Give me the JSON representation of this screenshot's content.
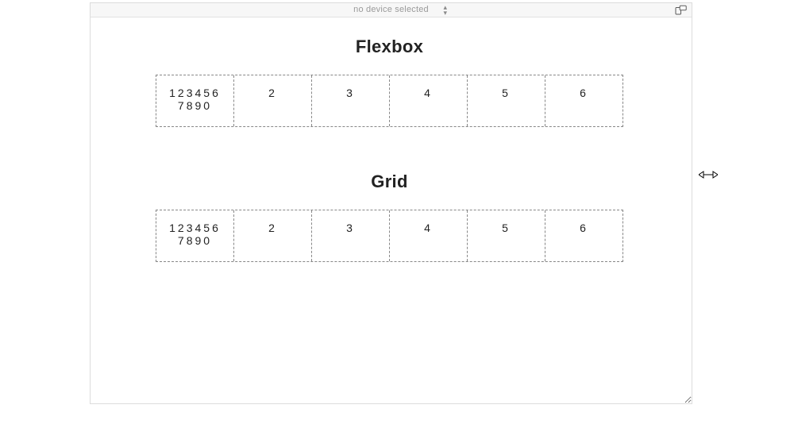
{
  "toolbar": {
    "device_label": "no device selected"
  },
  "sections": {
    "flexbox": {
      "title": "Flexbox"
    },
    "grid": {
      "title": "Grid"
    }
  },
  "cells": {
    "c1": "1234567890",
    "c2": "2",
    "c3": "3",
    "c4": "4",
    "c5": "5",
    "c6": "6"
  }
}
